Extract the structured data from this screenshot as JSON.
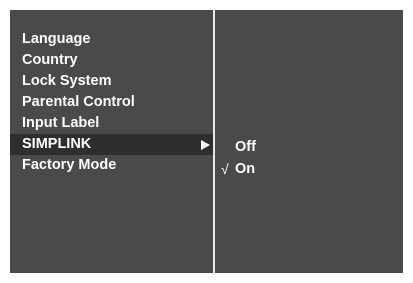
{
  "menu": {
    "items": [
      {
        "label": "Language"
      },
      {
        "label": "Country"
      },
      {
        "label": "Lock System"
      },
      {
        "label": "Parental Control"
      },
      {
        "label": "Input Label"
      },
      {
        "label": "SIMPLINK",
        "selected": true,
        "icon": "triangle-right-icon"
      },
      {
        "label": "Factory Mode"
      }
    ]
  },
  "submenu": {
    "options": [
      {
        "label": "Off",
        "checked": false
      },
      {
        "label": "On",
        "checked": true,
        "check_glyph": "√"
      }
    ]
  },
  "colors": {
    "panel_bg": "#4a4a4a",
    "selected_bg": "#2e2e2e",
    "text": "#ffffff",
    "divider": "#e8e8e8"
  }
}
